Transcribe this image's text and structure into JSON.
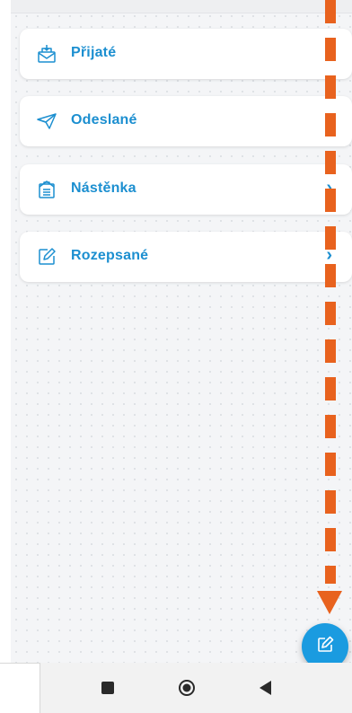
{
  "menu": {
    "items": [
      {
        "label": "Přijaté",
        "icon": "inbox-icon",
        "chevron": "›"
      },
      {
        "label": "Odeslané",
        "icon": "paper-plane-icon",
        "chevron": "›"
      },
      {
        "label": "Nástěnka",
        "icon": "board-icon",
        "chevron": "›"
      },
      {
        "label": "Rozepsané",
        "icon": "edit-draft-icon",
        "chevron": "›"
      }
    ]
  },
  "fab": {
    "icon": "compose-icon"
  },
  "nav_bar": {
    "buttons": [
      "recents-square-icon",
      "home-circle-icon",
      "back-triangle-icon"
    ]
  },
  "colors": {
    "accent": "#1c8fd0",
    "fab": "#1a9be0",
    "annotation": "#e8621e",
    "background": "#f4f5f7"
  }
}
